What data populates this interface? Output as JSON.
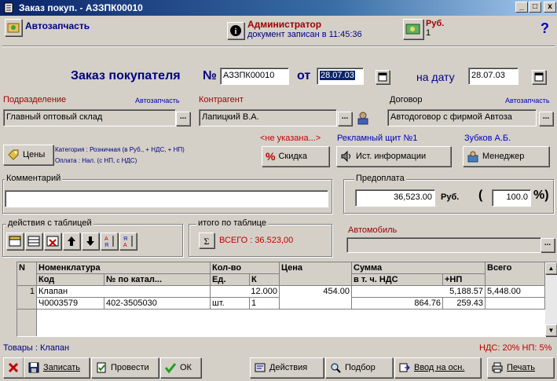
{
  "window": {
    "title": "Заказ покуп. - АЗЗПК00010",
    "btn_min": "_",
    "btn_max": "□",
    "btn_close": "x"
  },
  "toolbar": {
    "company": "Автозапчасть",
    "user_name": "Администратор",
    "doc_saved": "документ записан в 11:45:36",
    "currency": "Руб.",
    "currency_rate": "1",
    "help": "?"
  },
  "header": {
    "title": "Заказ покупателя",
    "number_label": "№",
    "number_value": "АЗЗПК00010",
    "from_label": "от",
    "date_value": "28.07.03",
    "on_date_label": "на дату",
    "on_date_value": "28.07.03"
  },
  "fields": {
    "division_label": "Подразделение",
    "division_hint": "Автозапчасть",
    "division_value": "Главный оптовый склад",
    "counterparty_label": "Контрагент",
    "counterparty_value": "Лапицкий В.А.",
    "contract_label": "Договор",
    "contract_hint": "Автозапчасть",
    "contract_value": "Автодоговор с фирмой Автоза",
    "prices_button": "Цены",
    "category_text": "Категория : Розничная (в Руб., + НДС, + НП)",
    "payment_text": "Оплата : Нал. (с НП, с НДС)",
    "discount_hint": "<не указана...>",
    "discount_button": "Скидка",
    "ad_hint": "Рекламный щит №1",
    "info_source_button": "Ист. информации",
    "manager_hint": "Зубков А.Б.",
    "manager_button": "Менеджер",
    "comment_label": "Комментарий",
    "comment_value": "",
    "prepay_label": "Предоплата",
    "prepay_value": "36,523.00",
    "prepay_currency": "Руб.",
    "prepay_paren_open": "(",
    "prepay_percent": "100.0",
    "prepay_paren_close": "%)",
    "car_label": "Автомобиль",
    "car_value": ""
  },
  "table_actions": {
    "group_label": "действия с таблицей",
    "total_label": "итого по таблице",
    "total_text": "ВСЕГО : 36.523,00"
  },
  "table": {
    "headers": {
      "n": "N",
      "nomenclature": "Номенклатура",
      "code": "Код",
      "catalog_no": "№ по катал...",
      "qty_group": "Кол-во",
      "unit": "Ед.",
      "k": "К",
      "price": "Цена",
      "sum": "Сумма",
      "vat_incl": "в т. ч. НДС",
      "np": "+НП",
      "total": "Всего"
    },
    "rows": [
      {
        "n": "1",
        "name": "Клапан",
        "code": "Ч0003579",
        "catalog_no": "402-3505030",
        "qty": "12.000",
        "unit": "шт.",
        "k": "1",
        "price": "454.00",
        "sum": "5,188.57",
        "vat": "864.76",
        "np": "259.43",
        "total": "5,448.00"
      }
    ]
  },
  "status": {
    "left": "Товары : Клапан",
    "right": "НДС: 20% НП: 5%"
  },
  "bottom": {
    "save": "Записать",
    "post": "Провести",
    "ok": "ОК",
    "actions": "Действия",
    "pick": "Подбор",
    "input_base": "Ввод на осн.",
    "print": "Печать"
  },
  "colors": {
    "title_blue": "#0a246a",
    "header_text": "#000080",
    "label_red": "#a00000",
    "hint_blue": "#0000c0",
    "hint_red": "#c00000",
    "total_red": "#c00000"
  }
}
